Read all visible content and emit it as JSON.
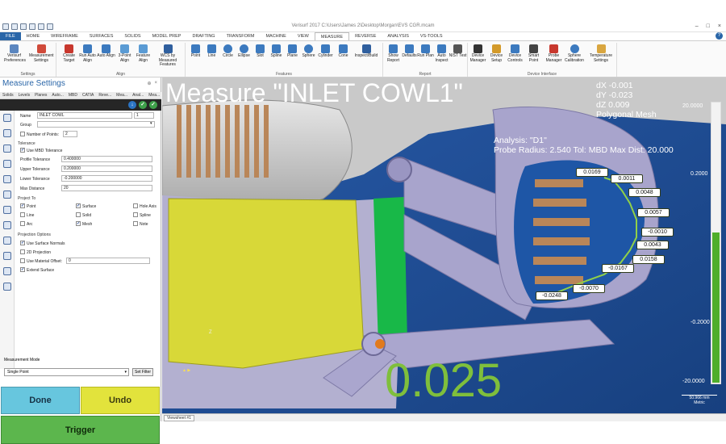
{
  "window": {
    "title": "Verisurf 2017  C:\\Users\\James 2\\Desktop\\Morgan\\EVS CGR.mcam",
    "controls": [
      "–",
      "□",
      "×"
    ]
  },
  "menu": {
    "tabs": [
      "FILE",
      "HOME",
      "WIREFRAME",
      "SURFACES",
      "SOLIDS",
      "MODEL PREP",
      "DRAFTING",
      "TRANSFORM",
      "MACHINE",
      "VIEW",
      "MEASURE",
      "REVERSE",
      "ANALYSIS",
      "VS-TOOLS"
    ],
    "active_tab": "MEASURE",
    "help": "?"
  },
  "ribbon": {
    "settings": {
      "label": "Settings",
      "buttons": [
        "Verisurf Preferences",
        "Measurement Settings"
      ]
    },
    "align": {
      "label": "Align",
      "buttons": [
        "Create Target",
        "Run Auto Align",
        "Auto Align",
        "3-Point Align",
        "Feature Align",
        "WCS by Measured Features"
      ]
    },
    "features": {
      "label": "Features",
      "buttons": [
        "Point",
        "Line",
        "Circle",
        "Ellipse",
        "Slot",
        "Spline",
        "Plane",
        "Sphere",
        "Cylinder",
        "Cone",
        "Inspect/Build"
      ]
    },
    "report": {
      "label": "Report",
      "buttons": [
        "Show Report",
        "Defaults",
        "Run Plan",
        "Auto Inspect",
        "NIST Test"
      ]
    },
    "device": {
      "label": "Device Interface",
      "buttons": [
        "Device Manager",
        "Device Setup",
        "Device Controls",
        "Smart Point",
        "Probe Manager",
        "Sphere Calibration",
        "Temperature Settings"
      ]
    }
  },
  "panel": {
    "title": "Measure Settings",
    "controls": [
      "⊕",
      "×"
    ],
    "tabs": [
      "Solids",
      "Levels",
      "Planes",
      "Auto...",
      "MBD",
      "CATIA",
      "Reve...",
      "Mea...",
      "Anal...",
      "Mea..."
    ],
    "form": {
      "name_label": "Name",
      "name_value": "INLET COWL",
      "name_num": "1",
      "group_label": "Group",
      "group_value": "",
      "num_points_label": "Number of Points:",
      "num_points_value": "2",
      "tolerance_section": "Tolerance",
      "use_mbd_label": "Use MBD Tolerance",
      "profile_label": "Profile Tolerance",
      "profile_value": "0.400000",
      "upper_label": "Upper Tolerance",
      "upper_value": "0.200000",
      "lower_label": "Lower Tolerance",
      "lower_value": "-0.200000",
      "maxdist_label": "Max Distance",
      "maxdist_value": "20",
      "project_section": "Project To",
      "proj_point": "Point",
      "proj_surface": "Surface",
      "proj_holeaxis": "Hole Axis",
      "proj_line": "Line",
      "proj_solid": "Solid",
      "proj_spline": "Spline",
      "proj_arc": "Arc",
      "proj_mesh": "Mesh",
      "proj_note": "Note",
      "projopt_section": "Projection Options",
      "opt_surface_normals": "Use Surface Normals",
      "opt_2d": "2D Projection",
      "opt_material_offset": "Use Material Offset:",
      "opt_material_value": "0",
      "opt_extend": "Extend Surface"
    },
    "mode_label": "Measurement Mode",
    "mode_value": "Single Point",
    "set_filter": "Set Filter",
    "done": "Done",
    "undo": "Undo",
    "trigger": "Trigger"
  },
  "viewport": {
    "title": "Measure \"INLET COWL1\"",
    "dx": "dX -0.001",
    "dy": "dY -0.023",
    "dz": "dZ  0.009",
    "mesh": "Polygonal Mesh",
    "analysis": "Analysis: \"D1\"",
    "probe": "Probe Radius: 2.540 Tol: MBD Max Dist: 20.000",
    "big_value": "0.025",
    "deviations": [
      "0.0169",
      "0.0011",
      "0.0048",
      "0.0057",
      "-0.0010",
      "0.0043",
      "0.0158",
      "-0.0167",
      "-0.0070",
      "-0.0248"
    ],
    "scale": {
      "top": "20.0000",
      "mid1": "0.2000",
      "mid2": "-0.2000",
      "bottom": "-20.0000"
    },
    "scale_bar": {
      "value": "50.966 mm",
      "unit": "Metric"
    },
    "coord_label": "Z",
    "sheet": "Viewsheet #1"
  },
  "colors": {
    "accent": "#2a66a8",
    "done": "#67c6de",
    "undo": "#e2e33c",
    "trigger": "#5cb64d",
    "big_value": "#7fbf3c",
    "viewport_bg": "#1f4c9a",
    "yellow_part": "#d8d838",
    "green_part": "#18b848"
  }
}
